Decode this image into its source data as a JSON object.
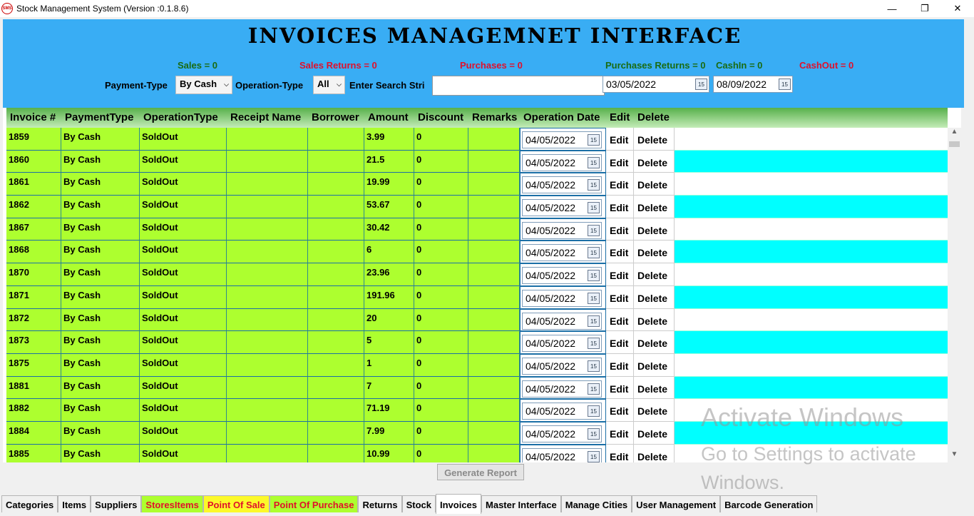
{
  "window": {
    "title": "Stock Management System (Version :0.1.8.6)",
    "icon_text": "SMS",
    "minimize": "—",
    "maximize": "❐",
    "close": "✕"
  },
  "header": {
    "title": "INVOICES MANAGEMNET INTERFACE",
    "stats": {
      "sales": "Sales = 0",
      "sales_returns": "Sales Returns = 0",
      "purchases": "Purchases = 0",
      "purchases_returns": "Purchases Returns = 0",
      "cash_in": "CashIn = 0",
      "cash_out": "CashOut = 0"
    },
    "filters": {
      "payment_type_label": "Payment-Type",
      "payment_type_value": "By Cash",
      "operation_type_label": "Operation-Type",
      "operation_type_value": "All",
      "search_label": "Enter Search Stri",
      "search_value": "",
      "date_from": "03/05/2022",
      "date_to": "08/09/2022",
      "calendar_icon_text": "15"
    }
  },
  "grid": {
    "columns": [
      "Invoice #",
      "PaymentType",
      "OperationType",
      "Receipt Name",
      "Borrower",
      "Amount",
      "Discount",
      "Remarks",
      "Operation Date",
      "Edit",
      "Delete"
    ],
    "edit_label": "Edit",
    "delete_label": "Delete",
    "rows": [
      {
        "invoice": "1859",
        "payment": "By Cash",
        "operation": "SoldOut",
        "receipt": "",
        "borrower": "",
        "amount": "3.99",
        "discount": "0",
        "remarks": "",
        "date": "04/05/2022"
      },
      {
        "invoice": "1860",
        "payment": "By Cash",
        "operation": "SoldOut",
        "receipt": "",
        "borrower": "",
        "amount": "21.5",
        "discount": "0",
        "remarks": "",
        "date": "04/05/2022"
      },
      {
        "invoice": "1861",
        "payment": "By Cash",
        "operation": "SoldOut",
        "receipt": "",
        "borrower": "",
        "amount": "19.99",
        "discount": "0",
        "remarks": "",
        "date": "04/05/2022"
      },
      {
        "invoice": "1862",
        "payment": "By Cash",
        "operation": "SoldOut",
        "receipt": "",
        "borrower": "",
        "amount": "53.67",
        "discount": "0",
        "remarks": "",
        "date": "04/05/2022"
      },
      {
        "invoice": "1867",
        "payment": "By Cash",
        "operation": "SoldOut",
        "receipt": "",
        "borrower": "",
        "amount": "30.42",
        "discount": "0",
        "remarks": "",
        "date": "04/05/2022"
      },
      {
        "invoice": "1868",
        "payment": "By Cash",
        "operation": "SoldOut",
        "receipt": "",
        "borrower": "",
        "amount": "6",
        "discount": "0",
        "remarks": "",
        "date": "04/05/2022"
      },
      {
        "invoice": "1870",
        "payment": "By Cash",
        "operation": "SoldOut",
        "receipt": "",
        "borrower": "",
        "amount": "23.96",
        "discount": "0",
        "remarks": "",
        "date": "04/05/2022"
      },
      {
        "invoice": "1871",
        "payment": "By Cash",
        "operation": "SoldOut",
        "receipt": "",
        "borrower": "",
        "amount": "191.96",
        "discount": "0",
        "remarks": "",
        "date": "04/05/2022"
      },
      {
        "invoice": "1872",
        "payment": "By Cash",
        "operation": "SoldOut",
        "receipt": "",
        "borrower": "",
        "amount": "20",
        "discount": "0",
        "remarks": "",
        "date": "04/05/2022"
      },
      {
        "invoice": "1873",
        "payment": "By Cash",
        "operation": "SoldOut",
        "receipt": "",
        "borrower": "",
        "amount": "5",
        "discount": "0",
        "remarks": "",
        "date": "04/05/2022"
      },
      {
        "invoice": "1875",
        "payment": "By Cash",
        "operation": "SoldOut",
        "receipt": "",
        "borrower": "",
        "amount": "1",
        "discount": "0",
        "remarks": "",
        "date": "04/05/2022"
      },
      {
        "invoice": "1881",
        "payment": "By Cash",
        "operation": "SoldOut",
        "receipt": "",
        "borrower": "",
        "amount": "7",
        "discount": "0",
        "remarks": "",
        "date": "04/05/2022"
      },
      {
        "invoice": "1882",
        "payment": "By Cash",
        "operation": "SoldOut",
        "receipt": "",
        "borrower": "",
        "amount": "71.19",
        "discount": "0",
        "remarks": "",
        "date": "04/05/2022"
      },
      {
        "invoice": "1884",
        "payment": "By Cash",
        "operation": "SoldOut",
        "receipt": "",
        "borrower": "",
        "amount": "7.99",
        "discount": "0",
        "remarks": "",
        "date": "04/05/2022"
      },
      {
        "invoice": "1885",
        "payment": "By Cash",
        "operation": "SoldOut",
        "receipt": "",
        "borrower": "",
        "amount": "10.99",
        "discount": "0",
        "remarks": "",
        "date": "04/05/2022"
      }
    ]
  },
  "footer": {
    "generate_report": "Generate Report",
    "watermark_title": "Activate Windows",
    "watermark_text": "Go to Settings to activate Windows."
  },
  "tabs": [
    {
      "label": "Categories",
      "style": "normal"
    },
    {
      "label": "Items",
      "style": "normal"
    },
    {
      "label": "Suppliers",
      "style": "normal"
    },
    {
      "label": "StoresItems",
      "style": "lime"
    },
    {
      "label": "Point Of Sale",
      "style": "yellow"
    },
    {
      "label": "Point Of Purchase",
      "style": "lime"
    },
    {
      "label": "Returns",
      "style": "normal"
    },
    {
      "label": "Stock",
      "style": "normal"
    },
    {
      "label": "Invoices",
      "style": "active"
    },
    {
      "label": "Master Interface",
      "style": "normal"
    },
    {
      "label": "Manage Cities",
      "style": "normal"
    },
    {
      "label": "User Management",
      "style": "normal"
    },
    {
      "label": "Barcode Generation",
      "style": "normal"
    }
  ],
  "colors": {
    "header_bg": "#39adf4",
    "row_green": "#adff2f",
    "row_cyan": "#00ffff",
    "stat_green": "#1a6b12",
    "stat_red": "#e0102b"
  }
}
